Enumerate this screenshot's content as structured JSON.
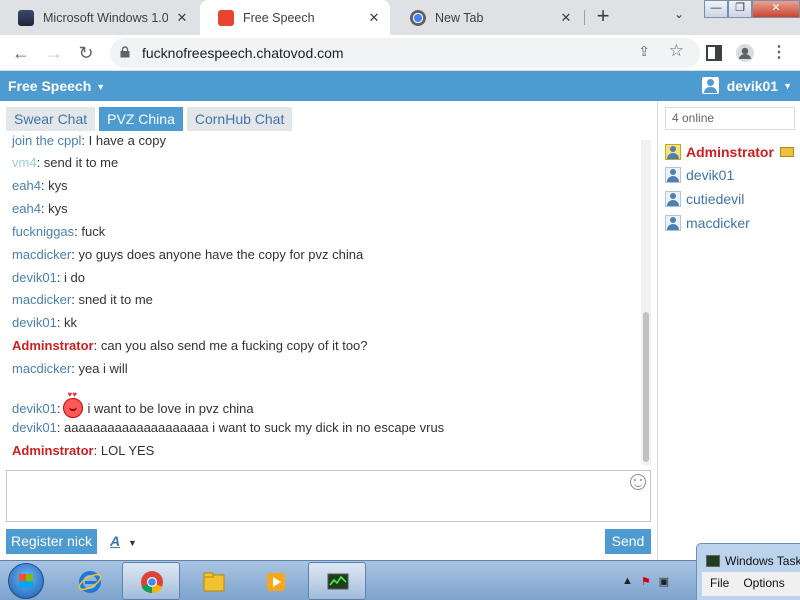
{
  "browser": {
    "tabs": [
      {
        "title": "Microsoft Windows 1.0",
        "active": false
      },
      {
        "title": "Free Speech",
        "active": true
      },
      {
        "title": "New Tab",
        "active": false
      }
    ],
    "new_tab": "+",
    "url": "fucknofreespeech.chatovod.com"
  },
  "chat": {
    "room_title": "Free Speech",
    "current_user": "devik01",
    "room_tabs": [
      "Swear Chat",
      "PVZ China",
      "CornHub Chat"
    ],
    "active_room_index": 1,
    "messages": [
      {
        "nick": "join the cppl",
        "text": ": I have a copy",
        "style": "normal"
      },
      {
        "nick": "vm4",
        "text": ": send it to me",
        "style": "faded"
      },
      {
        "nick": "eah4",
        "text": ": kys",
        "style": "normal"
      },
      {
        "nick": "eah4",
        "text": ": kys",
        "style": "normal"
      },
      {
        "nick": "fuckniggas",
        "text": ": fuck",
        "style": "normal"
      },
      {
        "nick": "macdicker",
        "text": ": yo guys does anyone have the copy for pvz china",
        "style": "normal"
      },
      {
        "nick": "devik01",
        "text": ": i do",
        "style": "normal"
      },
      {
        "nick": "macdicker",
        "text": ": sned it to me",
        "style": "normal"
      },
      {
        "nick": "devik01",
        "text": ": kk",
        "style": "normal"
      },
      {
        "nick": "Adminstrator",
        "text": ": can you also send me a fucking copy of it too?",
        "style": "admin"
      },
      {
        "nick": "macdicker",
        "text": ": yea i will",
        "style": "normal"
      },
      {
        "nick": "devik01",
        "text": "i want to be love in pvz china",
        "style": "normal",
        "emoji": "in-love-emoji"
      },
      {
        "nick": "devik01",
        "text": ": aaaaaaaaaaaaaaaaaaaa i want to suck my dick in no escape vrus",
        "style": "normal"
      },
      {
        "nick": "Adminstrator",
        "text": ": LOL YES",
        "style": "admin"
      }
    ],
    "register_label": "Register nick",
    "font_label": "A",
    "send_label": "Send"
  },
  "sidebar": {
    "online_count": "4 online",
    "users": [
      {
        "name": "Adminstrator",
        "role": "admin"
      },
      {
        "name": "devik01",
        "role": "user"
      },
      {
        "name": "cutiedevil",
        "role": "user"
      },
      {
        "name": "macdicker",
        "role": "user"
      }
    ]
  },
  "taskmgr": {
    "title": "Windows Task",
    "menu": [
      "File",
      "Options"
    ]
  },
  "colors": {
    "accent": "#4d9bd0",
    "admin": "#cc1f1f",
    "nick": "#4a7fb2"
  }
}
